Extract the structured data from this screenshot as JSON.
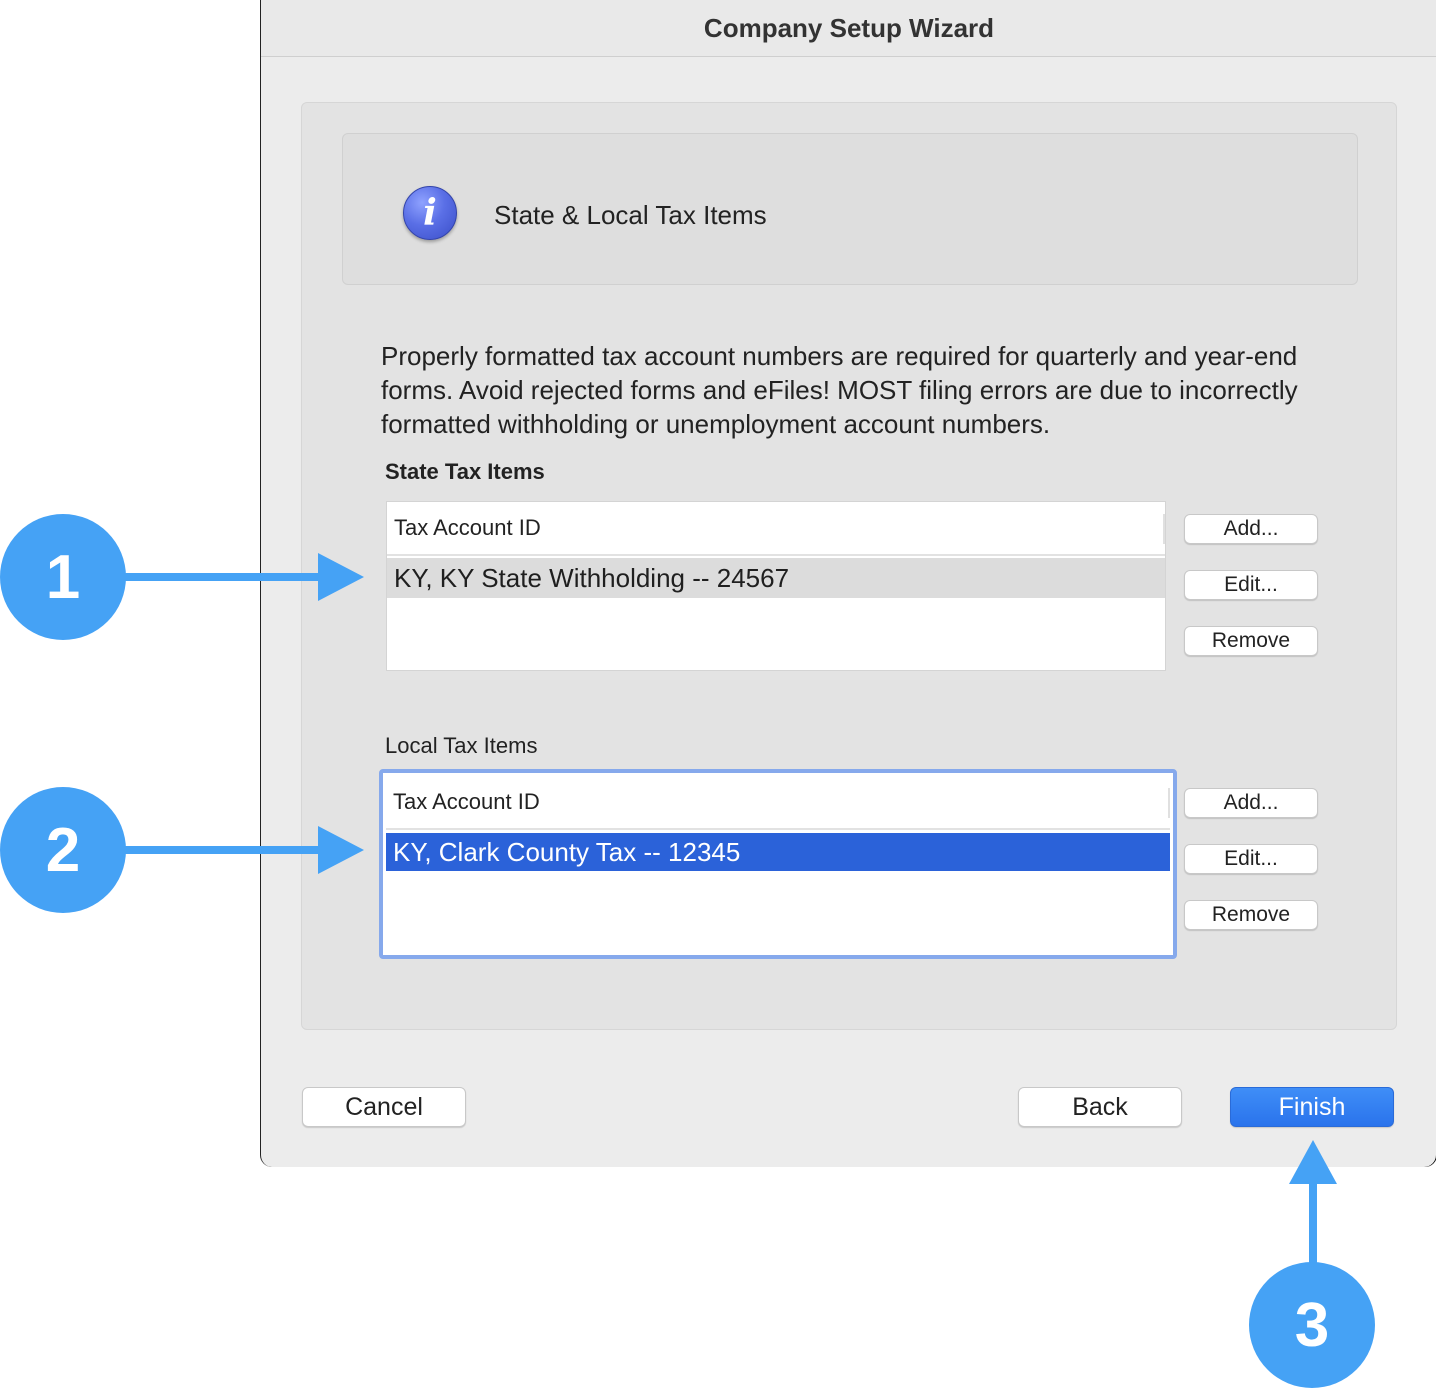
{
  "window": {
    "title": "Company Setup Wizard"
  },
  "header": {
    "icon": "info-icon",
    "title": "State & Local Tax Items"
  },
  "description": "Properly formatted tax account numbers are required for quarterly and year-end forms. Avoid rejected forms and eFiles! MOST filing errors are due to incorrectly formatted withholding or unemployment account numbers.",
  "state_tax": {
    "label": "State Tax Items",
    "column_header": "Tax Account ID",
    "rows": [
      "KY, KY State Withholding -- 24567"
    ],
    "buttons": {
      "add": "Add...",
      "edit": "Edit...",
      "remove": "Remove"
    }
  },
  "local_tax": {
    "label": "Local Tax Items",
    "column_header": "Tax Account ID",
    "rows": [
      "KY, Clark County Tax -- 12345"
    ],
    "buttons": {
      "add": "Add...",
      "edit": "Edit...",
      "remove": "Remove"
    }
  },
  "footer": {
    "cancel": "Cancel",
    "back": "Back",
    "finish": "Finish"
  },
  "callouts": [
    "1",
    "2",
    "3"
  ],
  "colors": {
    "accent": "#2b62d9",
    "callout": "#45a2f5",
    "focus_ring": "#86a9ec"
  }
}
